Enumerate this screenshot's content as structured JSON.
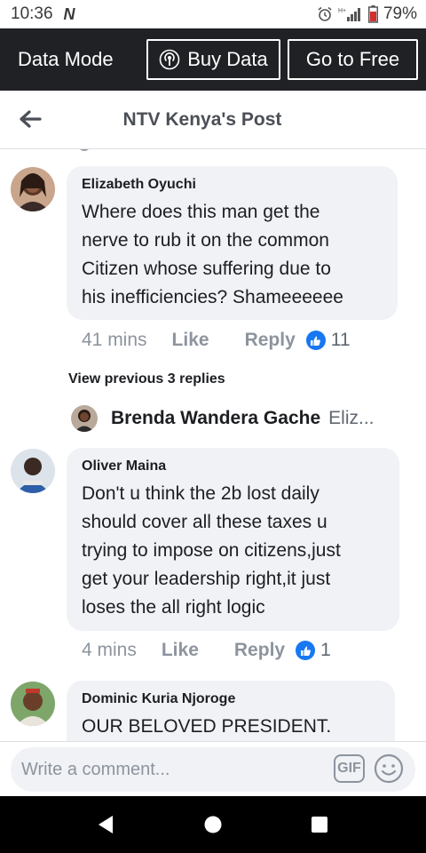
{
  "status": {
    "time": "10:36",
    "carrier_glyph": "N",
    "battery": "79%",
    "icons": [
      "alarm-icon",
      "signal-icon",
      "battery-icon"
    ]
  },
  "data_bar": {
    "label": "Data Mode",
    "buy_label": "Buy Data",
    "free_label": "Go to Free"
  },
  "header": {
    "title": "NTV Kenya's Post"
  },
  "comments": [
    {
      "author": "Elizabeth Oyuchi",
      "lines": [
        "Where does this man get the",
        "nerve to rub it on the common",
        "Citizen whose suffering due to",
        "his inefficiencies? Shameeeeee"
      ],
      "time": "41 mins",
      "like": "Like",
      "reply": "Reply",
      "reactions": "11"
    },
    {
      "author": "Oliver Maina",
      "lines": [
        "Don't u think the 2b lost daily",
        "should cover all these taxes u",
        "trying to impose on citizens,just",
        "get your leadership right,it just",
        "loses the all right logic"
      ],
      "time": "4 mins",
      "like": "Like",
      "reply": "Reply",
      "reactions": "1"
    },
    {
      "author": "Dominic Kuria Njoroge",
      "lines": [
        "OUR BELOVED PRESIDENT."
      ]
    }
  ],
  "replies": {
    "view_previous": "View previous 3 replies",
    "author": "Brenda Wandera Gache",
    "snippet": "Eliz..."
  },
  "composer": {
    "placeholder": "Write a comment...",
    "gif_label": "GIF"
  },
  "colors": {
    "accent": "#1877f2",
    "bubble": "#f0f2f5",
    "data_bar": "#1f2124"
  }
}
